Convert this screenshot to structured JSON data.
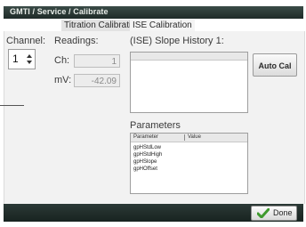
{
  "window": {
    "title": "GMTI / Service / Calibrate"
  },
  "tabs": [
    {
      "label": "Titration Calibration"
    },
    {
      "label": "ISE Calibration"
    }
  ],
  "channel": {
    "label": "Channel:",
    "value": "1"
  },
  "readings": {
    "label": "Readings:",
    "ch_label": "Ch:",
    "ch_value": "1",
    "mv_label": "mV:",
    "mv_value": "-42.09"
  },
  "slope_history": {
    "title": "(ISE) Slope History 1:"
  },
  "auto_cal": {
    "label": "Auto Cal"
  },
  "parameters": {
    "title": "Parameters",
    "columns": [
      "Parameter",
      "Value"
    ],
    "rows": [
      {
        "name": "gpHStdLow"
      },
      {
        "name": "gpHStdHigh"
      },
      {
        "name": "gpHSlope"
      },
      {
        "name": "gpHOffset"
      }
    ]
  },
  "done": {
    "label": "Done"
  },
  "colors": {
    "accent_green": "#3f9a2e",
    "titlebar": "#2a3734"
  },
  "icons": {
    "channel_spin": "up-down-arrows",
    "done": "green-checkmark"
  }
}
